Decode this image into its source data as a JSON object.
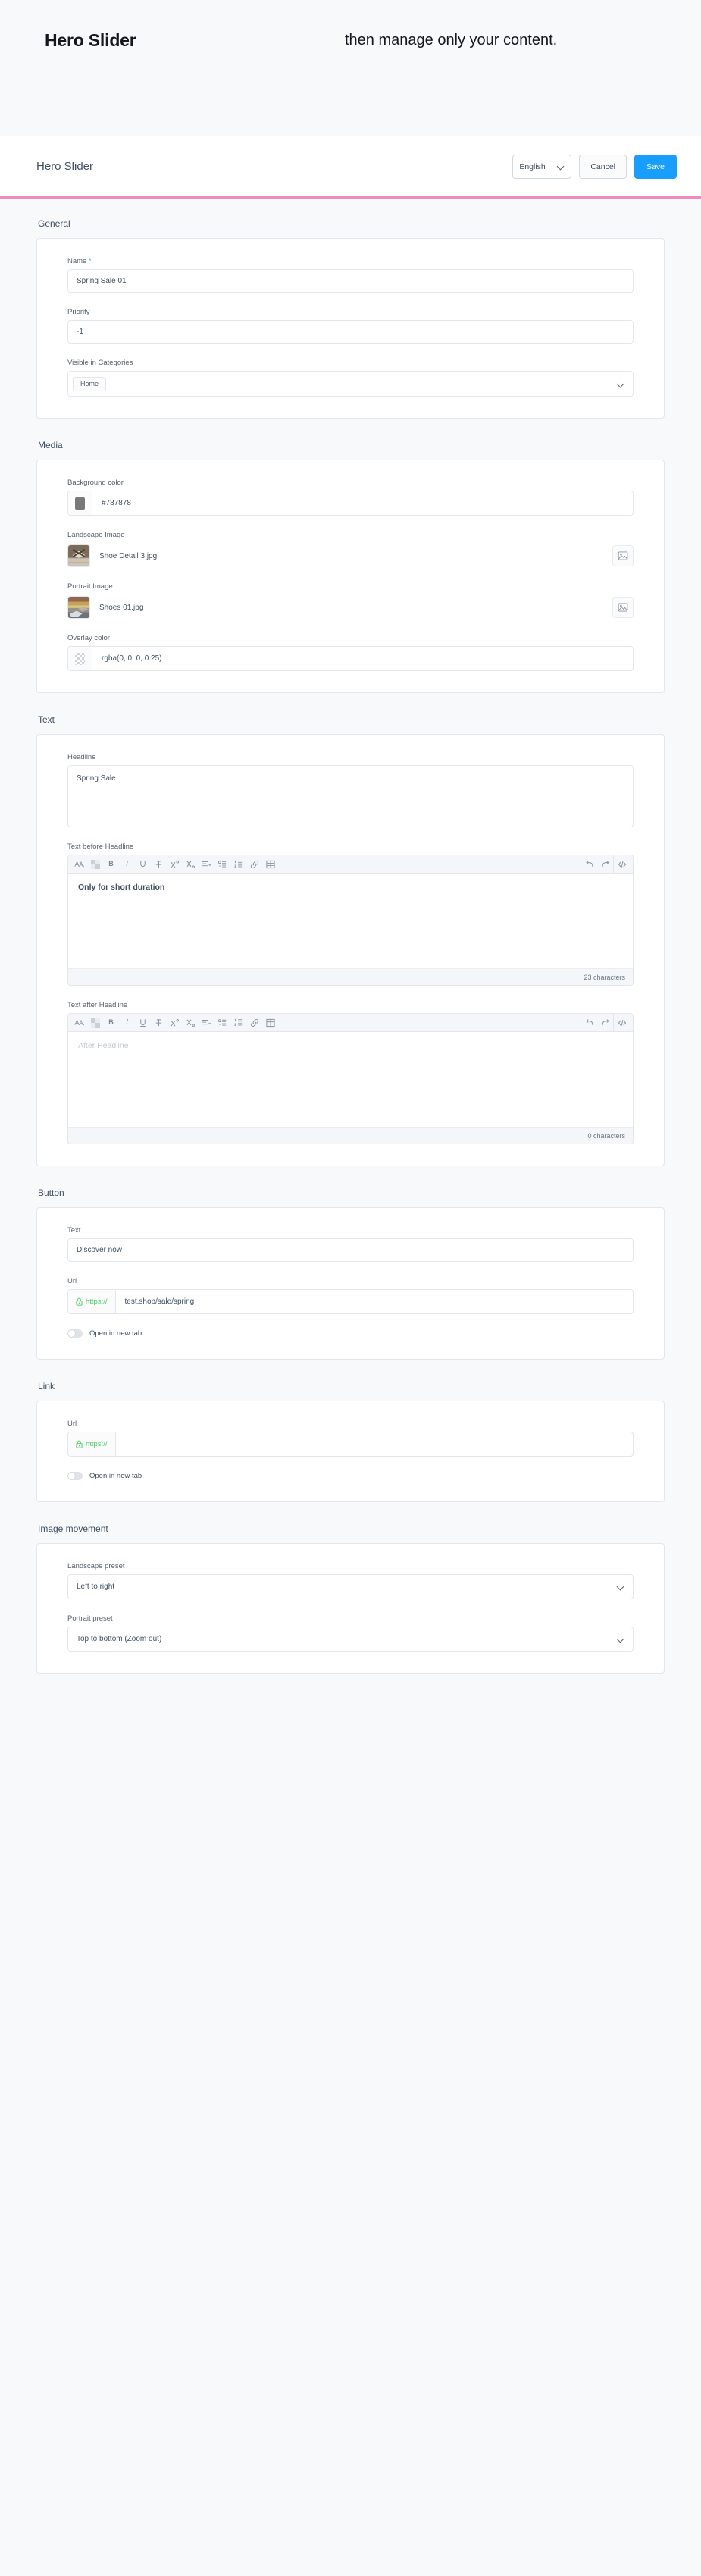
{
  "banner": {
    "brand_title": "Hero Slider",
    "tagline": "then manage only your content."
  },
  "header": {
    "page_title": "Hero Slider",
    "language_value": "English",
    "cancel_label": "Cancel",
    "save_label": "Save"
  },
  "sections": {
    "general": {
      "title": "General",
      "name_label": "Name",
      "name_required_mark": "*",
      "name_value": "Spring Sale 01",
      "priority_label": "Priority",
      "priority_value": "-1",
      "categories_label": "Visible in Categories",
      "categories_tags": [
        "Home"
      ]
    },
    "media": {
      "title": "Media",
      "background_color_label": "Background color",
      "background_color_value": "#787878",
      "background_color_hex": "#787878",
      "landscape_label": "Landscape Image",
      "landscape_filename": "Shoe Detail 3.jpg",
      "portrait_label": "Portrait Image",
      "portrait_filename": "Shoes 01.jpg",
      "overlay_color_label": "Overlay color",
      "overlay_color_value": "rgba(0, 0, 0, 0.25)"
    },
    "text": {
      "title": "Text",
      "headline_label": "Headline",
      "headline_value": "Spring Sale",
      "before_label": "Text before Headline",
      "before_value": "Only for short duration",
      "before_counter": "23 characters",
      "after_label": "Text after Headline",
      "after_placeholder": "After Headline",
      "after_counter": "0 characters"
    },
    "button": {
      "title": "Button",
      "text_label": "Text",
      "text_value": "Discover now",
      "url_label": "Url",
      "url_prefix": "https://",
      "url_value": "test.shop/sale/spring",
      "new_tab_label": "Open in new tab"
    },
    "link": {
      "title": "Link",
      "url_label": "Url",
      "url_prefix": "https://",
      "url_value": "",
      "new_tab_label": "Open in new tab"
    },
    "image_movement": {
      "title": "Image movement",
      "landscape_preset_label": "Landscape preset",
      "landscape_preset_value": "Left to right",
      "portrait_preset_label": "Portrait preset",
      "portrait_preset_value": "Top to bottom (Zoom out)"
    }
  },
  "editor_toolbar": {
    "buttons": [
      "format-style-icon",
      "text-color-icon",
      "bold-icon",
      "italic-icon",
      "underline-icon",
      "strikethrough-icon",
      "superscript-icon",
      "subscript-icon",
      "align-icon",
      "bullet-list-icon",
      "numbered-list-icon",
      "link-icon",
      "table-icon"
    ],
    "right_buttons": [
      "undo-icon",
      "redo-icon",
      "code-view-icon"
    ]
  },
  "colors": {
    "accent": "#189eff",
    "underline": "#f08bbd",
    "url_prefix_green": "#4cd26a",
    "page_bg": "#f8f9fb"
  }
}
